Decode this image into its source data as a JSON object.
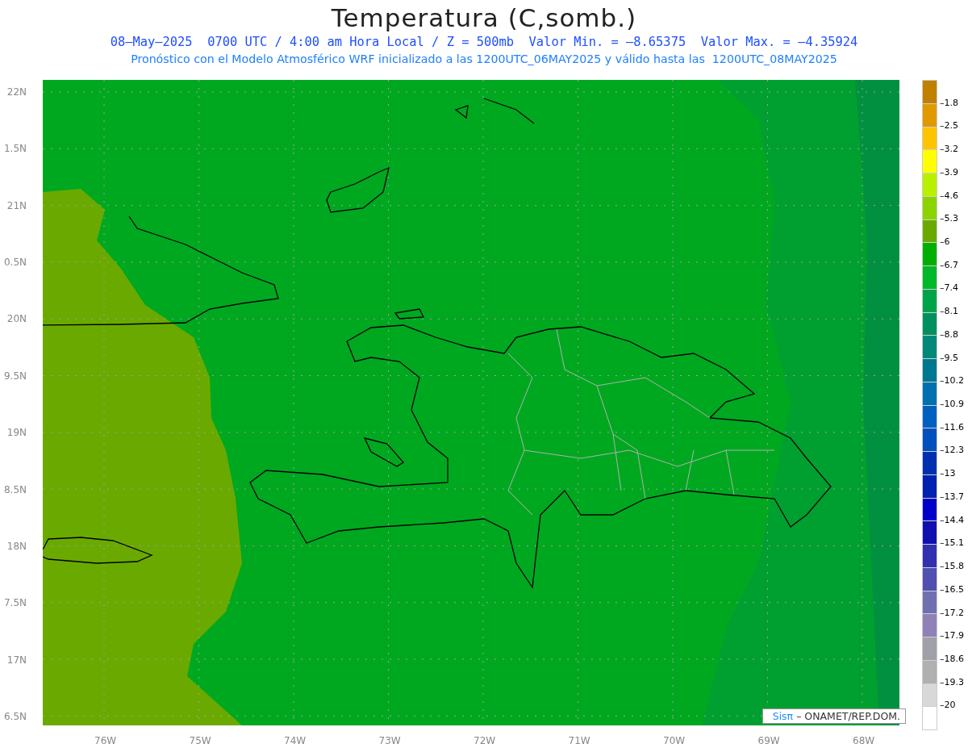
{
  "title": "Temperatura (C,somb.)",
  "subtitle_lines": [
    "08–May–2025  0700 UTC / 4:00 am Hora Local / Z = 500mb  Valor Min. = –8.65375  Valor Max. = –4.35924",
    "Pronóstico con el Modelo Atmosférico WRF inicializado a las 1200UTC_06MAY2025 y válido hasta las  1200UTC_08MAY2025"
  ],
  "map": {
    "y_labels": [
      "22N",
      "1.5N",
      "21N",
      "0.5N",
      "20N",
      "9.5N",
      "19N",
      "8.5N",
      "18N",
      "7.5N",
      "17N",
      "6.5N"
    ],
    "x_labels": [
      "76W",
      "75W",
      "74W",
      "73W",
      "72W",
      "71W",
      "70W",
      "69W",
      "68W"
    ],
    "credit": {
      "brand": "Sisπ",
      "text": "– ONAMET/REP.DOM."
    }
  },
  "colorbar": [
    {
      "color": "#c08000",
      "label": "–1.8"
    },
    {
      "color": "#e09a00",
      "label": "–2.5"
    },
    {
      "color": "#ffc400",
      "label": "–3.2"
    },
    {
      "color": "#ffff00",
      "label": "–3.9"
    },
    {
      "color": "#b8f000",
      "label": "–4.6"
    },
    {
      "color": "#8cd400",
      "label": "–5.3"
    },
    {
      "color": "#6aaa00",
      "label": "–6"
    },
    {
      "color": "#00b000",
      "label": "–6.7"
    },
    {
      "color": "#00b828",
      "label": "–7.4"
    },
    {
      "color": "#00a448",
      "label": "–8.1"
    },
    {
      "color": "#009060",
      "label": "–8.8"
    },
    {
      "color": "#008878",
      "label": "–9.5"
    },
    {
      "color": "#007890",
      "label": "–10.2"
    },
    {
      "color": "#0070b0",
      "label": "–10.9"
    },
    {
      "color": "#0060c0",
      "label": "–11.6"
    },
    {
      "color": "#0050c0",
      "label": "–12.3"
    },
    {
      "color": "#0030b0",
      "label": "–13"
    },
    {
      "color": "#0020b0",
      "label": "–13.7"
    },
    {
      "color": "#0000c8",
      "label": "–14.4"
    },
    {
      "color": "#1010b0",
      "label": "–15.1"
    },
    {
      "color": "#3030b0",
      "label": "–15.8"
    },
    {
      "color": "#5050b0",
      "label": "–16.5"
    },
    {
      "color": "#7070b0",
      "label": "–17.2"
    },
    {
      "color": "#9080b8",
      "label": "–17.9"
    },
    {
      "color": "#a0a0a8",
      "label": "–18.6"
    },
    {
      "color": "#b0b0b0",
      "label": "–19.3"
    },
    {
      "color": "#d8d8d8",
      "label": "–20"
    },
    {
      "color": "#ffffff"
    }
  ]
}
